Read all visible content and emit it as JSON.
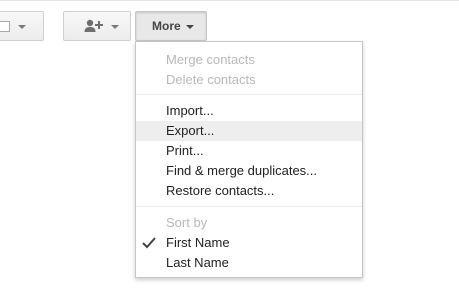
{
  "toolbar": {
    "more_label": "More"
  },
  "menu": {
    "items": [
      {
        "label": "Merge contacts"
      },
      {
        "label": "Delete contacts"
      },
      {
        "label": "Import..."
      },
      {
        "label": "Export..."
      },
      {
        "label": "Print..."
      },
      {
        "label": "Find & merge duplicates..."
      },
      {
        "label": "Restore contacts..."
      },
      {
        "label": "Sort by"
      },
      {
        "label": "First Name"
      },
      {
        "label": "Last Name"
      }
    ]
  },
  "icons": {
    "add_person": "add-person-icon",
    "select": "checkbox-icon",
    "checked": "checkmark-icon"
  }
}
